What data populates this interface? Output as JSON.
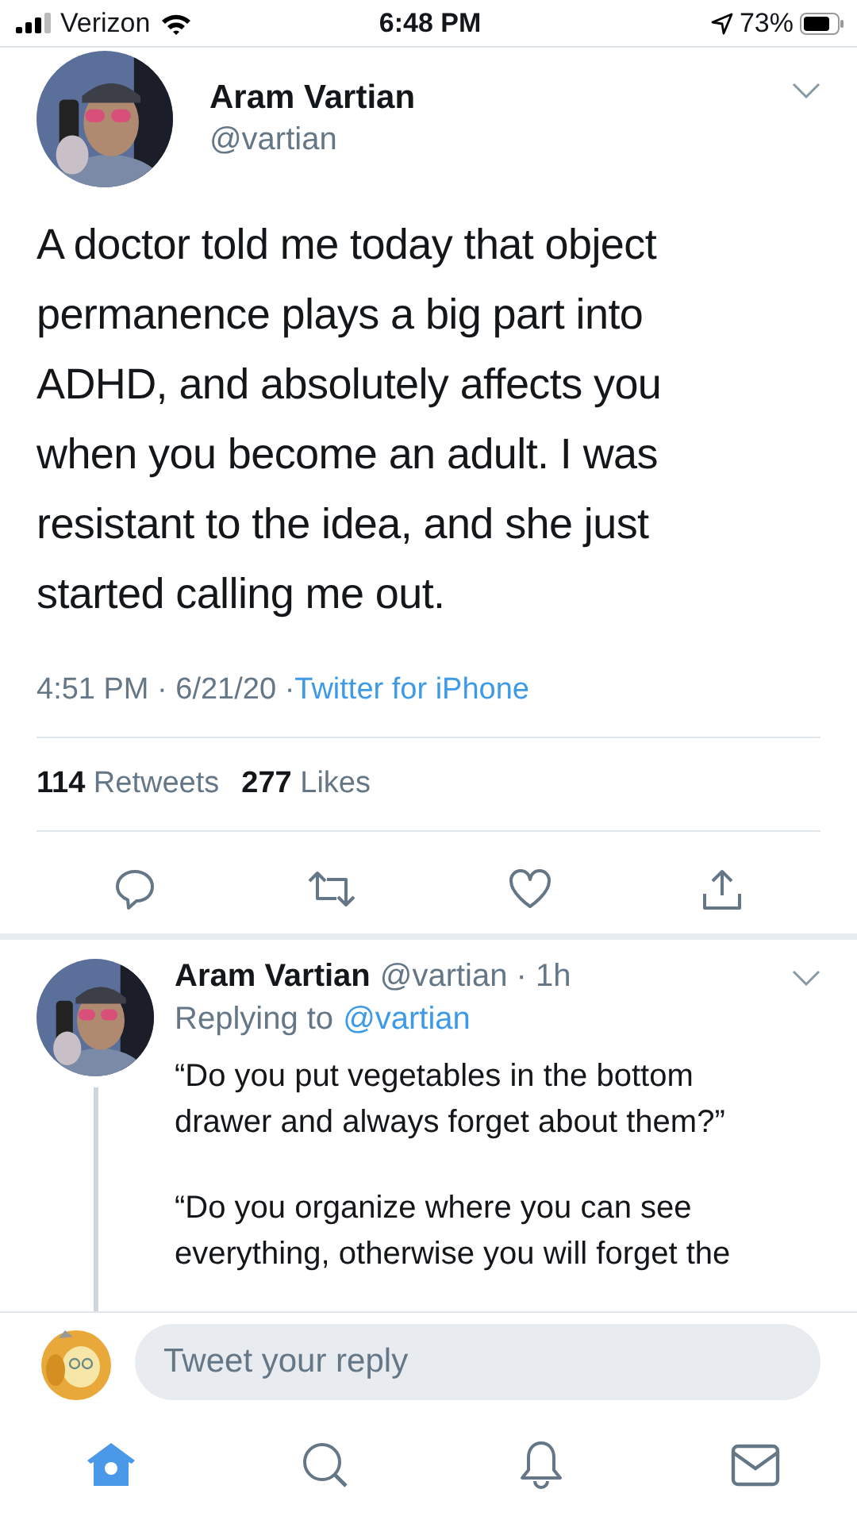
{
  "status_bar": {
    "carrier": "Verizon",
    "time": "6:48 PM",
    "battery": "73%"
  },
  "tweet": {
    "name": "Aram Vartian",
    "handle": "@vartian",
    "text": "A doctor told me today that object permanence plays a big part into ADHD, and absolutely affects you when you become an adult. I was resistant to the idea, and she just started calling me out.",
    "timestamp": "4:51 PM · 6/21/20 ·",
    "source": "Twitter for iPhone",
    "retweets": "114",
    "retweets_label": "Retweets",
    "likes": "277",
    "likes_label": "Likes"
  },
  "reply": {
    "name": "Aram Vartian",
    "handle_time": "@vartian · 1h",
    "replying_label": "Replying to",
    "replying_to": "@vartian",
    "paragraphs": [
      "“Do you put vegetables in the bottom drawer and always forget about them?”",
      "“Do you organize where you can see everything, otherwise you will forget the"
    ]
  },
  "composer": {
    "placeholder": "Tweet your reply"
  },
  "tabs": [
    {
      "kind": "home",
      "selected": true
    },
    {
      "kind": "search",
      "selected": false
    },
    {
      "kind": "notifications",
      "selected": false
    },
    {
      "kind": "messages",
      "selected": false
    }
  ]
}
